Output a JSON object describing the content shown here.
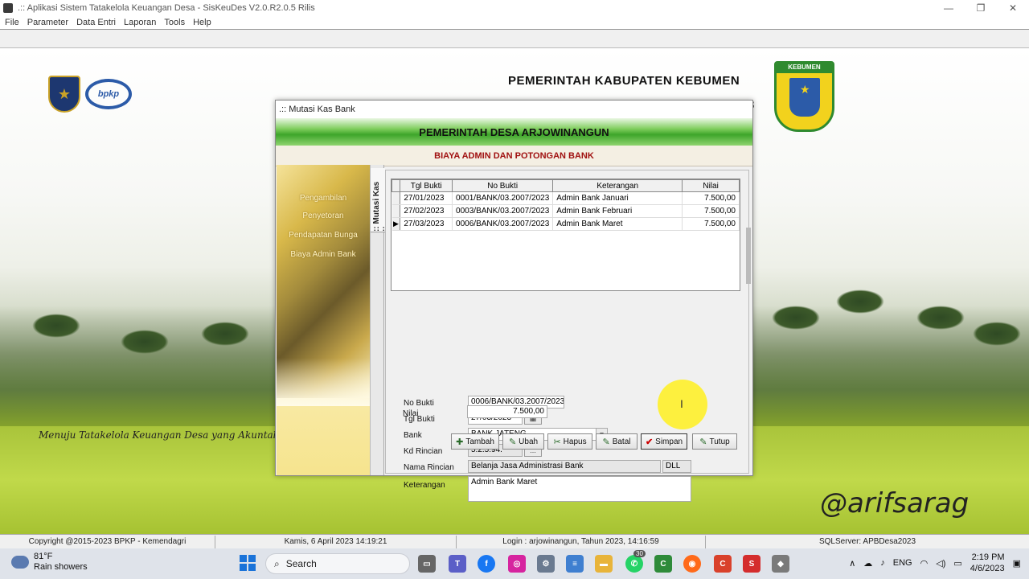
{
  "window": {
    "title": ".:: Aplikasi Sistem Tatakelola Keuangan Desa - SisKeuDes V2.0.R2.0.5 Rilis",
    "controls": [
      "—",
      "❐",
      "✕"
    ]
  },
  "menu": [
    "File",
    "Parameter",
    "Data Entri",
    "Laporan",
    "Tools",
    "Help"
  ],
  "header": {
    "government": "PEMERINTAH KABUPATEN KEBUMEN",
    "year_fragment": "3",
    "crest_label": "KEBUMEN",
    "bpkp_logo": "bpkp",
    "slogan": "Menuju Tatakelola Keuangan Desa yang Akuntab",
    "watermark": "@arifsarag"
  },
  "dialog": {
    "title": ".:: Mutasi Kas Bank",
    "banner": "PEMERINTAH DESA ARJOWINANGUN",
    "subtitle": "BIAYA ADMIN DAN POTONGAN BANK",
    "side_links": [
      "Pengambilan",
      "Penyetoran",
      "Pendapatan Bunga",
      "Biaya Admin Bank"
    ],
    "side_tab": ":: Mutasi Kas ::",
    "grid": {
      "columns": [
        "Tgl Bukti",
        "No Bukti",
        "Keterangan",
        "Nilai"
      ],
      "rows": [
        {
          "tgl": "27/01/2023",
          "no": "0001/BANK/03.2007/2023",
          "ket": "Admin Bank Januari",
          "nilai": "7.500,00",
          "selected": false
        },
        {
          "tgl": "27/02/2023",
          "no": "0003/BANK/03.2007/2023",
          "ket": "Admin Bank Februari",
          "nilai": "7.500,00",
          "selected": false
        },
        {
          "tgl": "27/03/2023",
          "no": "0006/BANK/03.2007/2023",
          "ket": "Admin Bank Maret",
          "nilai": "7.500,00",
          "selected": true
        }
      ]
    },
    "form": {
      "no_bukti_label": "No Bukti",
      "no_bukti": "0006/BANK/03.2007/2023",
      "tgl_bukti_label": "Tgl Bukti",
      "tgl_bukti": "27/03/2023",
      "bank_label": "Bank",
      "bank": "BANK JATENG",
      "kd_rincian_label": "Kd Rincian",
      "kd_rincian": "5.2.5.94.",
      "kd_btn": "...",
      "nama_rincian_label": "Nama Rincian",
      "nama_rincian": "Belanja Jasa Administrasi Bank",
      "nama_rincian_code": "DLL",
      "keterangan_label": "Keterangan",
      "keterangan": "Admin Bank Maret",
      "nilai_label": "Nilai",
      "nilai": "7.500,00"
    },
    "buttons": {
      "tambah": "Tambah",
      "ubah": "Ubah",
      "hapus": "Hapus",
      "batal": "Batal",
      "simpan": "Simpan",
      "tutup": "Tutup"
    }
  },
  "statusbar": {
    "copyright": "Copyright @2015-2023 BPKP - Kemendagri",
    "date": "Kamis, 6 April 2023  14:19:21",
    "login": "Login : arjowinangun,  Tahun 2023, 14:16:59",
    "server": "SQLServer: APBDesa2023"
  },
  "taskbar": {
    "weather_temp": "81°F",
    "weather_desc": "Rain showers",
    "search_placeholder": "Search",
    "whatsapp_badge": "30",
    "lang": "ENG",
    "time": "2:19 PM",
    "date": "4/6/2023"
  }
}
